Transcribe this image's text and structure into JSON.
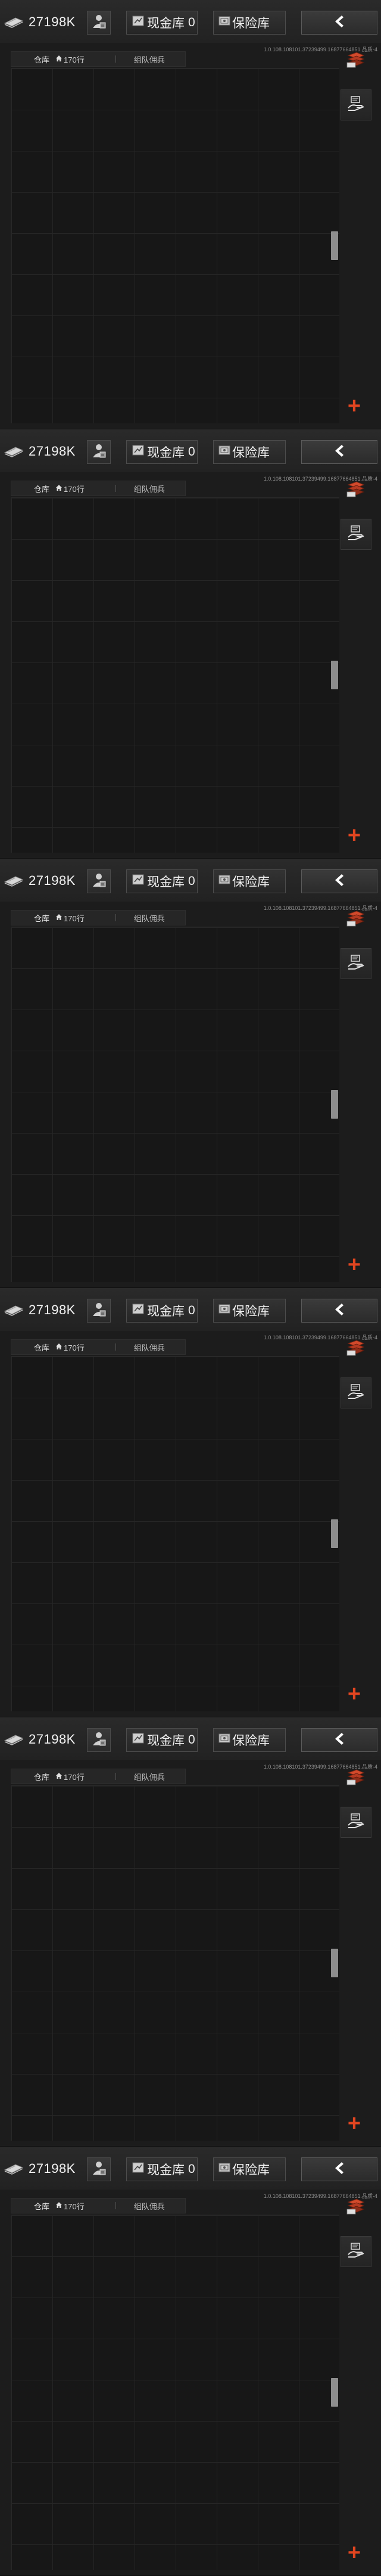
{
  "screen": {
    "money_amount": "27198K",
    "cash_label": "现金库",
    "cash_value": "0",
    "safe_label": "保险库",
    "version": "1.0.108.108101.37239499.16877664851.品质-4",
    "tab_storage_label": "仓库",
    "tab_storage_count": "170行",
    "tab_team_label": "组队佣兵",
    "add_label": "+",
    "scroll_position": 0.5
  },
  "panels": [
    {
      "id": 1
    },
    {
      "id": 2
    },
    {
      "id": 3
    },
    {
      "id": 4
    },
    {
      "id": 5
    },
    {
      "id": 6
    }
  ],
  "colors": {
    "background": "#1c1c1c",
    "accent": "#e24520",
    "text": "#e6e6e6"
  },
  "icons": {
    "money": "banknote-icon",
    "market": "merchant-icon",
    "cash": "cash-icon",
    "safe": "safe-icon",
    "back": "chevron-left-icon",
    "sort": "sort-items-icon",
    "transfer": "hand-transfer-icon",
    "home": "home-icon",
    "add": "plus-icon"
  }
}
